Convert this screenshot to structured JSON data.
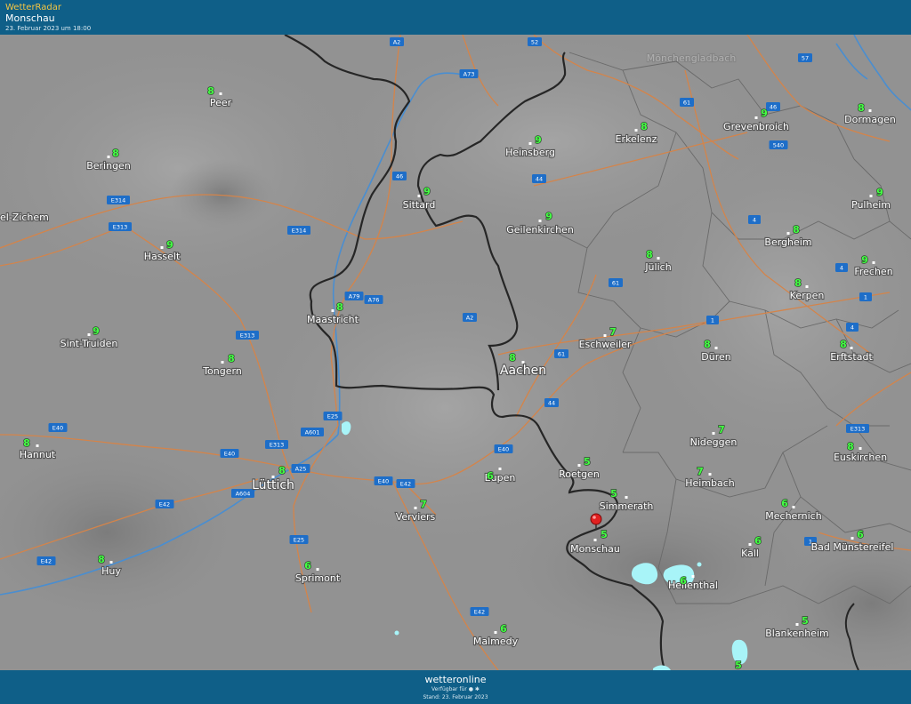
{
  "header": {
    "brand": "WetterRadar",
    "location": "Monschau",
    "datetime": "23. Februar 2023 um 18:00"
  },
  "footer": {
    "logo": "wetteronline",
    "available": "Verfügbar für",
    "stand": "Stand: 23. Februar 2023"
  },
  "colors": {
    "bar": "#0f5f88",
    "border": "#222222",
    "roads": "#d4844a",
    "rivers": "#4a8ed0",
    "temperature": "#44ff44",
    "precipitation": "#a8f4f8",
    "marker": "#e02020"
  },
  "places": [
    {
      "name": "Peer",
      "temp": "8"
    },
    {
      "name": "Beringen",
      "temp": "8"
    },
    {
      "name": "el-Zichem",
      "temp": ""
    },
    {
      "name": "Hasselt",
      "temp": "9"
    },
    {
      "name": "Sint-Truiden",
      "temp": "9"
    },
    {
      "name": "Tongern",
      "temp": "8"
    },
    {
      "name": "Hannut",
      "temp": "8"
    },
    {
      "name": "Lüttich",
      "temp": "8"
    },
    {
      "name": "Huy",
      "temp": "8"
    },
    {
      "name": "Sprimont",
      "temp": "6"
    },
    {
      "name": "Verviers",
      "temp": "7"
    },
    {
      "name": "Eupen",
      "temp": "6"
    },
    {
      "name": "Malmedy",
      "temp": "6"
    },
    {
      "name": "Maastricht",
      "temp": "8"
    },
    {
      "name": "Sittard",
      "temp": "9"
    },
    {
      "name": "Heinsberg",
      "temp": "9"
    },
    {
      "name": "Geilenkirchen",
      "temp": "9"
    },
    {
      "name": "Erkelenz",
      "temp": "8"
    },
    {
      "name": "Grevenbroich",
      "temp": "9"
    },
    {
      "name": "Dormagen",
      "temp": "8"
    },
    {
      "name": "Pulheim",
      "temp": "9"
    },
    {
      "name": "Bergheim",
      "temp": "8"
    },
    {
      "name": "Frechen",
      "temp": "9"
    },
    {
      "name": "Kerpen",
      "temp": "8"
    },
    {
      "name": "Erftstadt",
      "temp": "8"
    },
    {
      "name": "Jülich",
      "temp": "8"
    },
    {
      "name": "Eschweiler",
      "temp": "7"
    },
    {
      "name": "Düren",
      "temp": "8"
    },
    {
      "name": "Aachen",
      "temp": "8"
    },
    {
      "name": "Roetgen",
      "temp": "5"
    },
    {
      "name": "Simmerath",
      "temp": "5"
    },
    {
      "name": "Monschau",
      "temp": "5"
    },
    {
      "name": "Nideggen",
      "temp": "7"
    },
    {
      "name": "Heimbach",
      "temp": "7"
    },
    {
      "name": "Euskirchen",
      "temp": "8"
    },
    {
      "name": "Mechernich",
      "temp": "6"
    },
    {
      "name": "Kall",
      "temp": "6"
    },
    {
      "name": "Bad Münstereifel",
      "temp": "6"
    },
    {
      "name": "Hellenthal",
      "temp": "6"
    },
    {
      "name": "Blankenheim",
      "temp": "5"
    },
    {
      "name": "Mönchengladbach",
      "temp": ""
    }
  ],
  "road_labels": [
    "A2",
    "A73",
    "52",
    "57",
    "61",
    "46",
    "540",
    "E314",
    "E313",
    "A79",
    "A76",
    "A2",
    "46",
    "44",
    "61",
    "4",
    "4",
    "1",
    "61",
    "4",
    "44",
    "E40",
    "E25",
    "A601",
    "E313",
    "E40",
    "A25",
    "A604",
    "E42",
    "E40",
    "E42",
    "E25",
    "E42",
    "E42",
    "1",
    "1",
    "E40",
    "E314",
    "E313",
    "E313"
  ],
  "extra_temps": [
    "5"
  ]
}
